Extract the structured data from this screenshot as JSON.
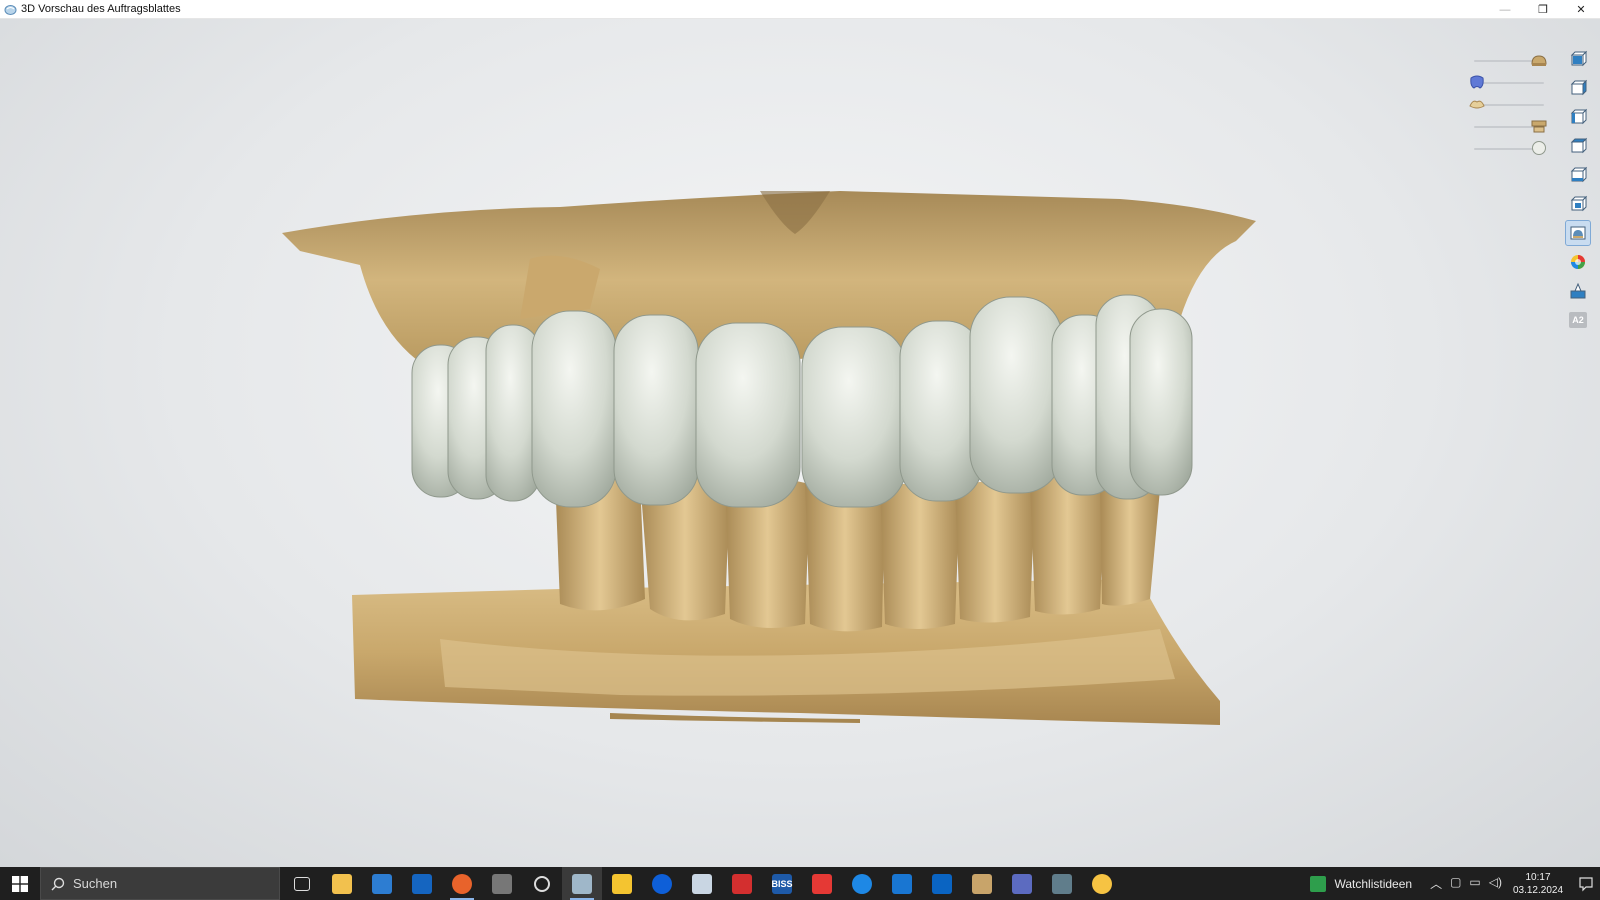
{
  "window": {
    "title": "3D Vorschau des Auftragsblattes",
    "controls": {
      "minimize": "—",
      "restore": "❐",
      "close": "✕"
    }
  },
  "viewer": {
    "sliders": [
      {
        "name": "upper-jaw-opacity",
        "value": 0.95,
        "icon": "jaw-model-icon"
      },
      {
        "name": "tooth-opacity",
        "value": 0.05,
        "icon": "tooth-blue-icon"
      },
      {
        "name": "gingiva-opacity",
        "value": 0.05,
        "icon": "gingiva-icon"
      },
      {
        "name": "antagonist-opacity",
        "value": 0.95,
        "icon": "antagonist-icon"
      },
      {
        "name": "sphere-opacity",
        "value": 0.95,
        "icon": "sphere-icon"
      }
    ],
    "toolbar": [
      {
        "icon": "view-front-icon",
        "active": false
      },
      {
        "icon": "view-back-icon",
        "active": false
      },
      {
        "icon": "view-left-icon",
        "active": false
      },
      {
        "icon": "view-right-icon",
        "active": false
      },
      {
        "icon": "view-top-icon",
        "active": false
      },
      {
        "icon": "view-bottom-icon",
        "active": false
      },
      {
        "icon": "view-3d-icon",
        "active": true
      },
      {
        "icon": "color-wheel-icon",
        "active": false
      },
      {
        "icon": "paint-icon",
        "active": false
      },
      {
        "icon": "shade-label-icon",
        "active": false,
        "label": "A2"
      }
    ]
  },
  "taskbar": {
    "search_placeholder": "Suchen",
    "watchlist_label": "Watchlistideen",
    "clock_time": "10:17",
    "clock_date": "03.12.2024",
    "apps": [
      {
        "icon": "task-view-icon",
        "color": "#1f1f1f"
      },
      {
        "icon": "file-explorer-icon",
        "color": "#f2c14e"
      },
      {
        "icon": "store-icon",
        "color": "#2d7dd2"
      },
      {
        "icon": "mail-icon",
        "color": "#1565c0"
      },
      {
        "icon": "firefox-icon",
        "color": "#e8632b"
      },
      {
        "icon": "camera-app-icon",
        "color": "#777777"
      },
      {
        "icon": "circle-app-icon",
        "color": "#1f1f1f"
      },
      {
        "icon": "dental-cad-icon",
        "color": "#9fb7c9"
      },
      {
        "icon": "chrome-like-icon",
        "color": "#f4c430"
      },
      {
        "icon": "teamviewer-icon",
        "color": "#0e5fd8"
      },
      {
        "icon": "scan-app-icon",
        "color": "#c9d6e3"
      },
      {
        "icon": "pdf-app-icon",
        "color": "#d32f2f"
      },
      {
        "icon": "biss-app-icon",
        "color": "#1e5aa8",
        "text": "BISS"
      },
      {
        "icon": "anydesk-icon",
        "color": "#e53935"
      },
      {
        "icon": "edge-like-icon",
        "color": "#1e88e5"
      },
      {
        "icon": "diamond-app-icon",
        "color": "#1976d2"
      },
      {
        "icon": "outlook-icon",
        "color": "#0a64c2"
      },
      {
        "icon": "person-app-icon",
        "color": "#c8a46a"
      },
      {
        "icon": "monitor-app-icon",
        "color": "#5c6bc0"
      },
      {
        "icon": "calculator-icon",
        "color": "#607d8b"
      },
      {
        "icon": "yellow-circle-app-icon",
        "color": "#f6c343"
      }
    ]
  }
}
